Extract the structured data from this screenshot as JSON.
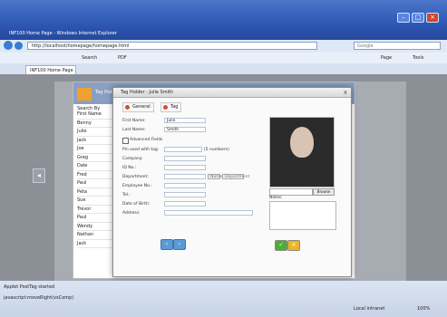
{
  "window": {
    "title": "INF100 Home Page - Windows Internet Explorer"
  },
  "address_bar": {
    "url": "http://localhost/homepage/homepage.html",
    "search_placeholder": "Google"
  },
  "toolbar": {
    "search_label": "Search",
    "pdf_label": "PDF",
    "page_label": "Page",
    "tools_label": "Tools"
  },
  "tab": {
    "label": "INF100 Home Page"
  },
  "background_panel": {
    "title": "Tag Holder",
    "column_header": "Search By",
    "rows": [
      "First Name",
      "Benny",
      "Julie",
      "Jack",
      "Joe",
      "Greg",
      "Dale",
      "Fred",
      "Paul",
      "Peta",
      "Sue",
      "Trevor",
      "Paul",
      "Wendy",
      "Nathan",
      "Jack"
    ]
  },
  "dialog": {
    "title": "Tag Holder : Julie Smith",
    "close": "x",
    "tabs": [
      {
        "label": "General"
      },
      {
        "label": "Tag"
      }
    ],
    "fields": {
      "first_name": {
        "label": "First Name:",
        "value": "Julie"
      },
      "last_name": {
        "label": "Last Name:",
        "value": "Smith"
      },
      "advanced": {
        "label": "Advanced Fields"
      },
      "pin": {
        "label": "Pin used with tag:",
        "hint": "(5 numbers)"
      },
      "company": {
        "label": "Company:"
      },
      "id": {
        "label": "ID No.:"
      },
      "department": {
        "label": "Department:",
        "btn1": "Name",
        "btn2": "Department"
      },
      "employee": {
        "label": "Employee No.:"
      },
      "tel": {
        "label": "Tel.:"
      },
      "dob": {
        "label": "Date of Birth:"
      },
      "address": {
        "label": "Address:"
      }
    },
    "browse_label": "Browse",
    "notes_label": "Notes:",
    "nav": {
      "prev": "‹",
      "next": "›"
    },
    "actions": {
      "ok": "✓",
      "cancel": "✕"
    }
  },
  "status": {
    "line1": "Applet PostTag started",
    "line2": "javascript:moveRight(vsComp)",
    "zone": "Local intranet",
    "zoom": "100%"
  },
  "colors": {
    "accent": "#3e63b8",
    "ok": "#4caf32",
    "cancel": "#f0b420"
  }
}
